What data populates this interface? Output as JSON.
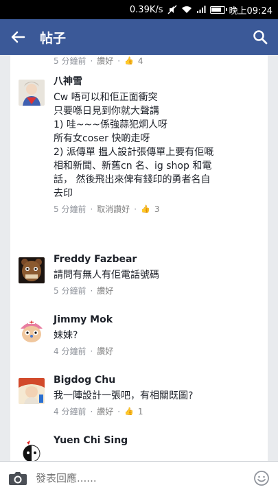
{
  "status": {
    "speed": "0.39K/s",
    "time": "晚上09:24"
  },
  "header": {
    "title": "帖子",
    "back_icon": "arrow-left-icon",
    "search_icon": "search-icon"
  },
  "colors": {
    "header_bg": "#3b5998",
    "link_gray": "#90949c",
    "like_blue": "#5b7bd5"
  },
  "top_meta": {
    "time": "5 分鐘前",
    "like": "讚好",
    "count": "4"
  },
  "comments": [
    {
      "name": "八神雪",
      "text": "Cw 唔可以和佢正面衝突\n只要喺日見到你就大聲講\n1) 哇~~~係強蒜犯炯人呀\n所有女coser 快啲走呀\n2) 派傳單 揾人設計張傳單上要有佢嘅\n相和新聞、新舊cn 名、ig shop 和電\n話， 然後飛出來俾有錢印的勇者名自\n去印",
      "time": "5 分鐘前",
      "like": "取消讚好",
      "count": "3"
    },
    {
      "name": "Freddy Fazbear",
      "text": "請問有無人有佢電話號碼",
      "time": "5 分鐘前",
      "like": "讚好",
      "count": ""
    },
    {
      "name": "Jimmy Mok",
      "text": "妹妹?",
      "time": "4 分鐘前",
      "like": "讚好",
      "count": ""
    },
    {
      "name": "Bigdog Chu",
      "text": "我一陣設計一張吧，有相關既圖?",
      "time": "4 分鐘前",
      "like": "讚好",
      "count": "1"
    },
    {
      "name": "Yuen Chi Sing",
      "text": "",
      "time": "",
      "like": "",
      "count": ""
    }
  ],
  "composer": {
    "placeholder": "發表回應......",
    "camera_icon": "camera-icon",
    "emoji_icon": "smiley-icon"
  }
}
